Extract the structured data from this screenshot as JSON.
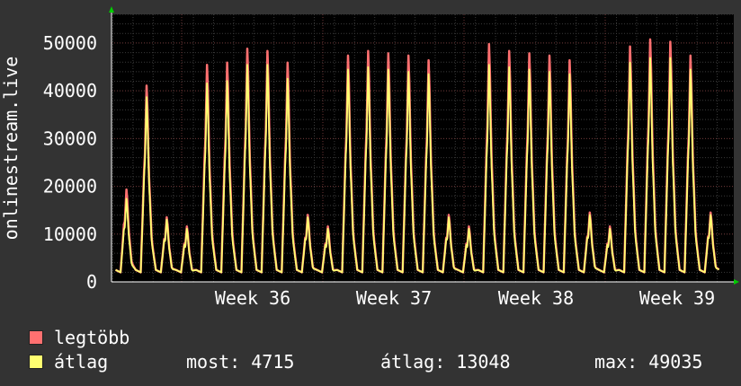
{
  "chart_data": {
    "type": "line",
    "ylabel": "onlinestream.live",
    "yticks": [
      0,
      10000,
      20000,
      30000,
      40000,
      50000
    ],
    "ylim": [
      0,
      56000
    ],
    "xticks": [
      "Week 36",
      "Week 37",
      "Week 38",
      "Week 39"
    ],
    "grid": true,
    "legend_position": "bottom-left",
    "series": [
      {
        "name": "legtöbb",
        "color": "#ff7070",
        "values": [
          20000,
          42500,
          14000,
          12000,
          47000,
          47500,
          50500,
          50000,
          47500,
          14500,
          12000,
          49000,
          50000,
          49500,
          49000,
          48000,
          14500,
          12000,
          51500,
          50000,
          49500,
          49000,
          48000,
          15000,
          12000,
          51000,
          52500,
          52000,
          49000,
          15000
        ]
      },
      {
        "name": "átlag",
        "color": "#ffff70",
        "values": [
          18000,
          40000,
          13500,
          11500,
          43000,
          43500,
          47000,
          47000,
          44000,
          14000,
          11500,
          46000,
          46500,
          46000,
          45500,
          45000,
          14000,
          11500,
          47000,
          46500,
          46000,
          45500,
          45000,
          14500,
          11500,
          47500,
          48500,
          48500,
          46000,
          14500
        ]
      }
    ]
  },
  "legend": {
    "items": [
      {
        "label": "legtöbb",
        "color": "#ff7070"
      },
      {
        "label": "átlag",
        "color": "#ffff70"
      }
    ]
  },
  "stats": {
    "most": "most: 4715",
    "atlag": "átlag: 13048",
    "max": "max: 49035"
  }
}
